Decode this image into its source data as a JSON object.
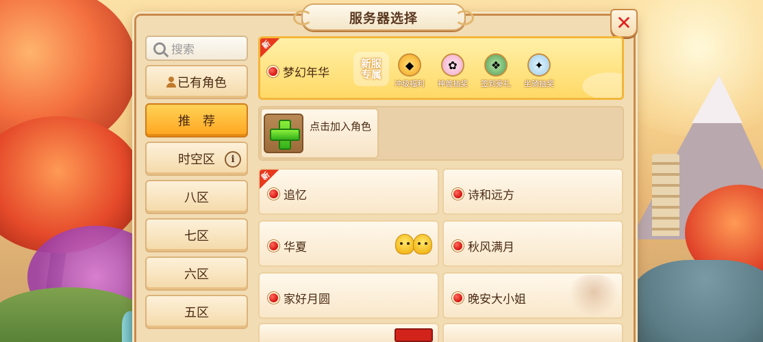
{
  "dialog": {
    "title": "服务器选择",
    "close_label": "✕"
  },
  "search": {
    "placeholder": "搜索"
  },
  "tabs": [
    {
      "label": "已有角色",
      "active": false
    },
    {
      "label": "推　荐",
      "active": true
    },
    {
      "label": "时空区",
      "active": false,
      "info": "i"
    },
    {
      "label": "八区",
      "active": false
    },
    {
      "label": "七区",
      "active": false
    },
    {
      "label": "六区",
      "active": false
    },
    {
      "label": "五区",
      "active": false
    }
  ],
  "featured": {
    "new_badge": "新",
    "name": "梦幻年华",
    "status": "hot",
    "promo_line1": "新服",
    "promo_line2": "专属",
    "perks": [
      {
        "label": "冲级福利",
        "icon": "gold-ingot-icon"
      },
      {
        "label": "神兽抽奖",
        "icon": "divine-beast-icon"
      },
      {
        "label": "签到豪礼",
        "icon": "dragon-gift-icon"
      },
      {
        "label": "坐骑抽奖",
        "icon": "unicorn-mount-icon"
      }
    ]
  },
  "add_role": {
    "label": "点击加入角色"
  },
  "servers": [
    {
      "name": "追忆",
      "new_badge": "新",
      "status": "hot"
    },
    {
      "name": "诗和远方",
      "status": "hot"
    },
    {
      "name": "华夏",
      "status": "hot",
      "decoration": "chick-icons"
    },
    {
      "name": "秋风满月",
      "status": "hot"
    },
    {
      "name": "家好月圆",
      "status": "hot"
    },
    {
      "name": "晚安大小姐",
      "status": "hot",
      "decoration": "portrait"
    }
  ],
  "colors": {
    "accent_orange": "#ffa51f",
    "status_red": "#d4130f",
    "close_red": "#e0211d",
    "panel_bg": "#f2dcb4"
  }
}
